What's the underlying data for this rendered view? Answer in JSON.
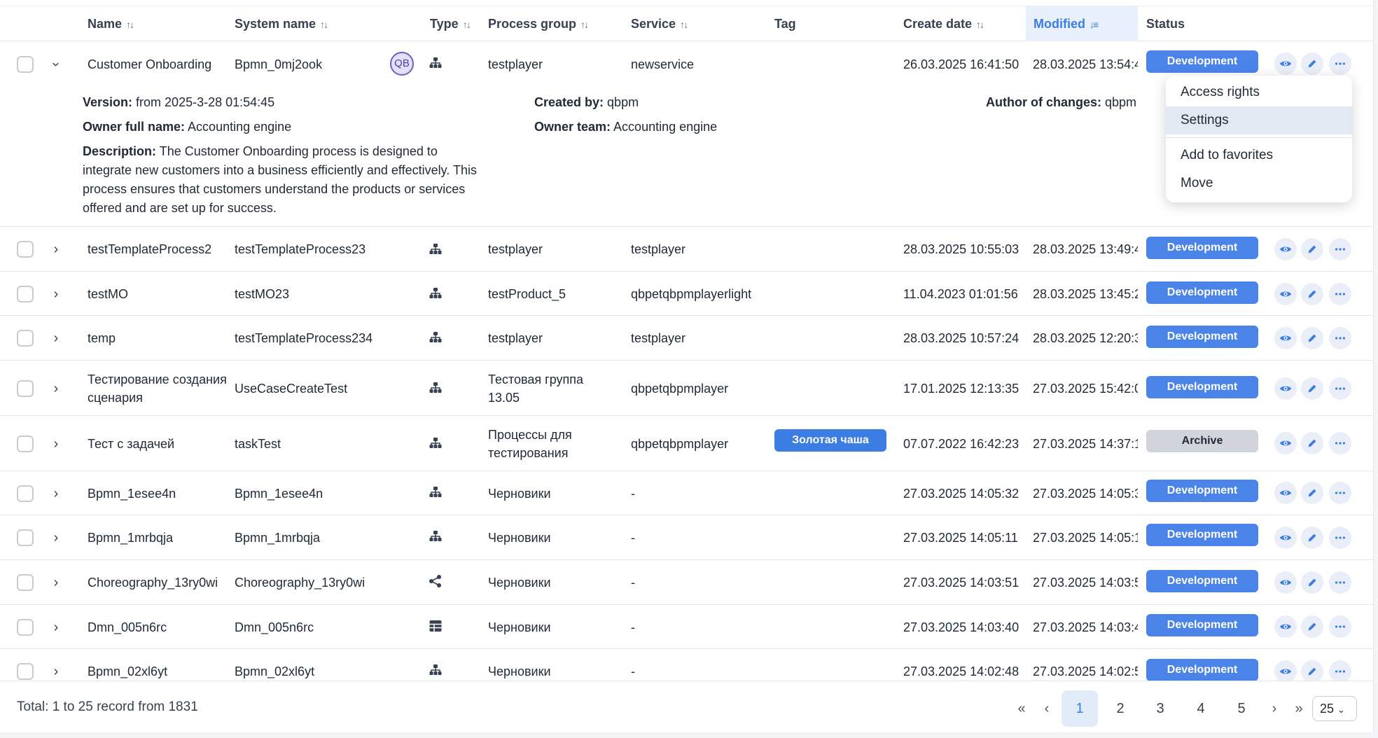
{
  "columns": {
    "name": "Name",
    "system_name": "System name",
    "type": "Type",
    "process_group": "Process group",
    "service": "Service",
    "tag": "Tag",
    "create_date": "Create date",
    "modified": "Modified",
    "status": "Status"
  },
  "sort_icons": {
    "unsorted": "↑↓",
    "desc": "↓≡"
  },
  "expanded": {
    "avatar_initials": "QB",
    "version_label": "Version:",
    "version_value": "from 2025-3-28 01:54:45",
    "created_by_label": "Created by:",
    "created_by_value": "qbpm",
    "author_label": "Author of changes:",
    "author_value": "qbpm",
    "owner_name_label": "Owner full name:",
    "owner_name_value": "Accounting engine",
    "owner_team_label": "Owner team:",
    "owner_team_value": "Accounting engine",
    "description_label": "Description:",
    "description_value": "The Customer Onboarding process is designed to integrate new customers into a business efficiently and effectively. This process ensures that customers understand the products or services offered and are set up for success."
  },
  "context_menu": {
    "items": [
      "Access rights",
      "Settings",
      "Add to favorites",
      "Move"
    ],
    "highlighted": "Settings"
  },
  "rows": [
    {
      "name": "Customer Onboarding",
      "system_name": "Bpmn_0mj2ook",
      "type_icon": "hierarchy-icon",
      "group": "testplayer",
      "service": "newservice",
      "tag": "",
      "created": "26.03.2025 16:41:50",
      "modified": "28.03.2025 13:54:4",
      "status": "Development"
    },
    {
      "name": "testTemplateProcess2",
      "system_name": "testTemplateProcess23",
      "type_icon": "hierarchy-icon",
      "group": "testplayer",
      "service": "testplayer",
      "tag": "",
      "created": "28.03.2025 10:55:03",
      "modified": "28.03.2025 13:49:4",
      "status": "Development"
    },
    {
      "name": "testMO",
      "system_name": "testMO23",
      "type_icon": "hierarchy-icon",
      "group": "testProduct_5",
      "service": "qbpetqbpmplayerlight",
      "tag": "",
      "created": "11.04.2023 01:01:56",
      "modified": "28.03.2025 13:45:2",
      "status": "Development"
    },
    {
      "name": "temp",
      "system_name": "testTemplateProcess234",
      "type_icon": "hierarchy-icon",
      "group": "testplayer",
      "service": "testplayer",
      "tag": "",
      "created": "28.03.2025 10:57:24",
      "modified": "28.03.2025 12:20:3",
      "status": "Development"
    },
    {
      "name": "Тестирование создания сценария",
      "system_name": "UseCaseCreateTest",
      "type_icon": "hierarchy-icon",
      "group": "Тестовая группа 13.05",
      "service": "qbpetqbpmplayer",
      "tag": "",
      "created": "17.01.2025 12:13:35",
      "modified": "27.03.2025 15:42:0",
      "status": "Development"
    },
    {
      "name": "Тест с задачей",
      "system_name": "taskTest",
      "type_icon": "hierarchy-icon",
      "group": "Процессы для тестирования",
      "service": "qbpetqbpmplayer",
      "tag": "Золотая чаша",
      "created": "07.07.2022 16:42:23",
      "modified": "27.03.2025 14:37:1",
      "status": "Archive"
    },
    {
      "name": "Bpmn_1esee4n",
      "system_name": "Bpmn_1esee4n",
      "type_icon": "hierarchy-icon",
      "group": "Черновики",
      "service": "-",
      "tag": "",
      "created": "27.03.2025 14:05:32",
      "modified": "27.03.2025 14:05:3",
      "status": "Development"
    },
    {
      "name": "Bpmn_1mrbqja",
      "system_name": "Bpmn_1mrbqja",
      "type_icon": "hierarchy-icon",
      "group": "Черновики",
      "service": "-",
      "tag": "",
      "created": "27.03.2025 14:05:11",
      "modified": "27.03.2025 14:05:1",
      "status": "Development"
    },
    {
      "name": "Choreography_13ry0wi",
      "system_name": "Choreography_13ry0wi",
      "type_icon": "share-icon",
      "group": "Черновики",
      "service": "-",
      "tag": "",
      "created": "27.03.2025 14:03:51",
      "modified": "27.03.2025 14:03:5",
      "status": "Development"
    },
    {
      "name": "Dmn_005n6rc",
      "system_name": "Dmn_005n6rc",
      "type_icon": "table-icon",
      "group": "Черновики",
      "service": "-",
      "tag": "",
      "created": "27.03.2025 14:03:40",
      "modified": "27.03.2025 14:03:4",
      "status": "Development"
    },
    {
      "name": "Bpmn_02xl6yt",
      "system_name": "Bpmn_02xl6yt",
      "type_icon": "hierarchy-icon",
      "group": "Черновики",
      "service": "-",
      "tag": "",
      "created": "27.03.2025 14:02:48",
      "modified": "27.03.2025 14:02:5",
      "status": "Development"
    }
  ],
  "footer": {
    "total": "Total: 1 to 25 record from 1831",
    "pages": [
      "1",
      "2",
      "3",
      "4",
      "5"
    ],
    "current_page": "1",
    "first": "«",
    "prev": "‹",
    "next": "›",
    "last": "»",
    "page_size": "25"
  },
  "colors": {
    "accent": "#3b7de3",
    "development_badge": "#4a84e8",
    "archive_badge": "#d1d5db",
    "menu_highlight": "#e3e9f3"
  }
}
